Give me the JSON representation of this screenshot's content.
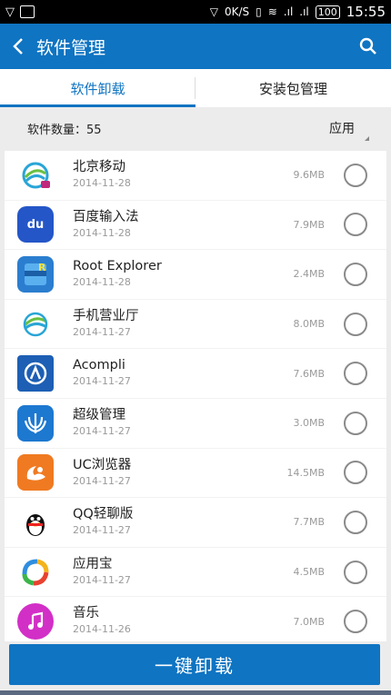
{
  "status_bar": {
    "speed": "0K/S",
    "battery": "100",
    "time": "15:55"
  },
  "app_bar": {
    "title": "软件管理"
  },
  "tabs": [
    {
      "label": "软件卸载",
      "active": true
    },
    {
      "label": "安装包管理",
      "active": false
    }
  ],
  "summary": {
    "count_label": "软件数量：55",
    "sort_label": "应用"
  },
  "apps": [
    {
      "name": "北京移动",
      "date": "2014-11-28",
      "size": "9.6MB",
      "icon": "china-mobile-icon",
      "color": "#ffffff"
    },
    {
      "name": "百度输入法",
      "date": "2014-11-28",
      "size": "7.9MB",
      "icon": "baidu-icon",
      "color": "#2456c8"
    },
    {
      "name": "Root Explorer",
      "date": "2014-11-28",
      "size": "2.4MB",
      "icon": "root-explorer-icon",
      "color": "#2b7ecf"
    },
    {
      "name": "手机营业厅",
      "date": "2014-11-27",
      "size": "8.0MB",
      "icon": "china-mobile-icon",
      "color": "#ffffff"
    },
    {
      "name": "Acompli",
      "date": "2014-11-27",
      "size": "7.6MB",
      "icon": "acompli-icon",
      "color": "#1d5fb4"
    },
    {
      "name": "超级管理",
      "date": "2014-11-27",
      "size": "3.0MB",
      "icon": "trident-icon",
      "color": "#1d78d0"
    },
    {
      "name": "UC浏览器",
      "date": "2014-11-27",
      "size": "14.5MB",
      "icon": "uc-icon",
      "color": "#f07a21"
    },
    {
      "name": "QQ轻聊版",
      "date": "2014-11-27",
      "size": "7.7MB",
      "icon": "penguin-icon",
      "color": "#ffffff"
    },
    {
      "name": "应用宝",
      "date": "2014-11-27",
      "size": "4.5MB",
      "icon": "app-store-icon",
      "color": "#ffffff"
    },
    {
      "name": "音乐",
      "date": "2014-11-26",
      "size": "7.0MB",
      "icon": "music-icon",
      "color": "#d22fc7"
    }
  ],
  "button": {
    "label": "一键卸载"
  },
  "colors": {
    "accent": "#0f74c2"
  }
}
